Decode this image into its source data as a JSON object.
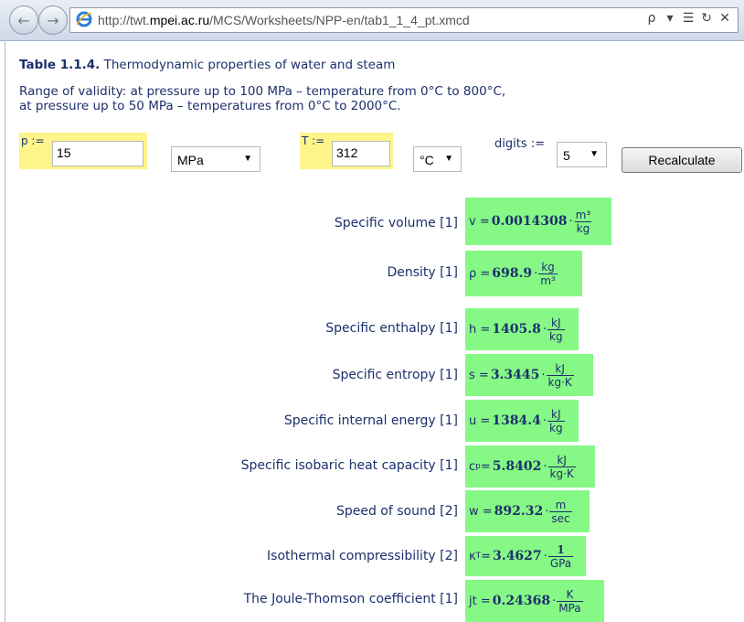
{
  "browser": {
    "url_prefix": "http://twt.",
    "url_domain": "mpei.ac.ru",
    "url_path": "/MCS/Worksheets/NPP-en/tab1_1_4_pt.xmcd",
    "tools": [
      "ρ",
      "▾",
      "☰",
      "↻",
      "✕"
    ]
  },
  "sheet": {
    "title_bold": "Table 1.1.4.",
    "title_rest": " Thermodynamic properties of water and steam",
    "range_line1": "Range of validity: at pressure up to 100 MPa – temperature from 0°C to 800°C,",
    "range_line2": "at pressure up to 50 MPa – temperatures from 0°C to 2000°C."
  },
  "inputs": {
    "p_label": "p :=",
    "p_value": "15",
    "p_unit": "MPa",
    "T_label": "T :=",
    "T_value": "312",
    "T_unit": "°C",
    "digits_label": "digits :=",
    "digits_value": "5",
    "recalculate_label": "Recalculate"
  },
  "properties": [
    {
      "label": "Specific volume [1]",
      "sym": "v =",
      "value": "0.0014308",
      "num": "m³",
      "den": "kg"
    },
    {
      "label": "Density [1]",
      "sym": "ρ =",
      "value": "698.9",
      "num": "kg",
      "den": "m³"
    },
    {
      "label": "Specific enthalpy [1]",
      "sym": "h =",
      "value": "1405.8",
      "num": "kJ",
      "den": "kg"
    },
    {
      "label": "Specific entropy [1]",
      "sym": "s =",
      "value": "3.3445",
      "num": "kJ",
      "den": "kg·K"
    },
    {
      "label": "Specific internal energy [1]",
      "sym": "u =",
      "value": "1384.4",
      "num": "kJ",
      "den": "kg"
    },
    {
      "label": "Specific isobaric heat capacity [1]",
      "sym": "c",
      "sym_sub": "p",
      "sym_eq": " =",
      "value": "5.8402",
      "num": "kJ",
      "den": "kg·K"
    },
    {
      "label": "Speed of sound [2]",
      "sym": "w =",
      "value": "892.32",
      "num": "m",
      "den": "sec"
    },
    {
      "label": "Isothermal compressibility [2]",
      "sym": "κ",
      "sym_sub": "T",
      "sym_eq": " =",
      "value": "3.4627",
      "num": "1",
      "den": "GPa"
    },
    {
      "label": "The Joule-Thomson coefficient [1]",
      "sym": "jt =",
      "value": "0.24368",
      "num": "K",
      "den": "MPa"
    }
  ]
}
